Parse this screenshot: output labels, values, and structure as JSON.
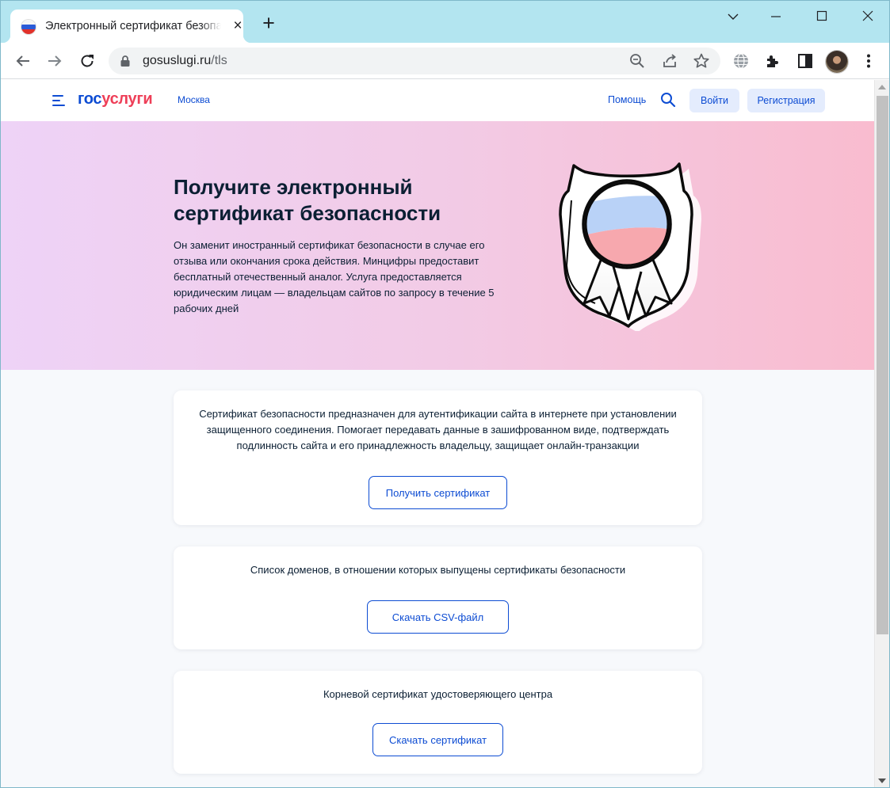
{
  "browser": {
    "tab_title": "Электронный сертификат безопасности",
    "url_host": "gosuslugi.ru",
    "url_path": "/tls"
  },
  "site": {
    "logo_part1": "гос",
    "logo_part2": "услуги",
    "city": "Москва",
    "help": "Помощь",
    "login": "Войти",
    "register": "Регистрация"
  },
  "hero": {
    "title": "Получите электронный сертификат безопасности",
    "text": "Он заменит иностранный сертификат безопасности в случае его отзыва или окончания срока действия. Минцифры предоставит бесплатный отечественный аналог. Услуга предоставляется юридическим лицам — владельцам сайтов по запросу в течение 5 рабочих дней"
  },
  "cards": [
    {
      "text": "Сертификат безопасности предназначен для аутентификации сайта в интернете при установлении защищенного соединения. Помогает передавать данные в зашифрованном виде, подтверждать подлинность сайта и его принадлежность владельцу, защищает онлайн-транзакции",
      "button": "Получить сертификат"
    },
    {
      "text": "Список доменов, в отношении которых выпущены сертификаты безопасности",
      "button": "Скачать CSV-файл"
    },
    {
      "text": "Корневой сертификат удостоверяющего центра",
      "button": "Скачать сертификат"
    }
  ],
  "colors": {
    "brand_blue": "#0d4cd3",
    "brand_red": "#ee3f58",
    "text": "#0b1f33",
    "hero_left": "#eed3f7",
    "hero_right": "#f9bccf"
  },
  "icons": [
    "russia-flag-icon",
    "close-icon",
    "plus-icon",
    "minimize-icon",
    "maximize-icon",
    "window-close-icon",
    "chevron-down-icon",
    "back-icon",
    "forward-icon",
    "reload-icon",
    "lock-icon",
    "zoom-icon",
    "share-icon",
    "star-icon",
    "globe-icon",
    "extensions-icon",
    "side-panel-icon",
    "more-icon",
    "menu-icon",
    "search-icon",
    "certificate-badge-icon"
  ]
}
